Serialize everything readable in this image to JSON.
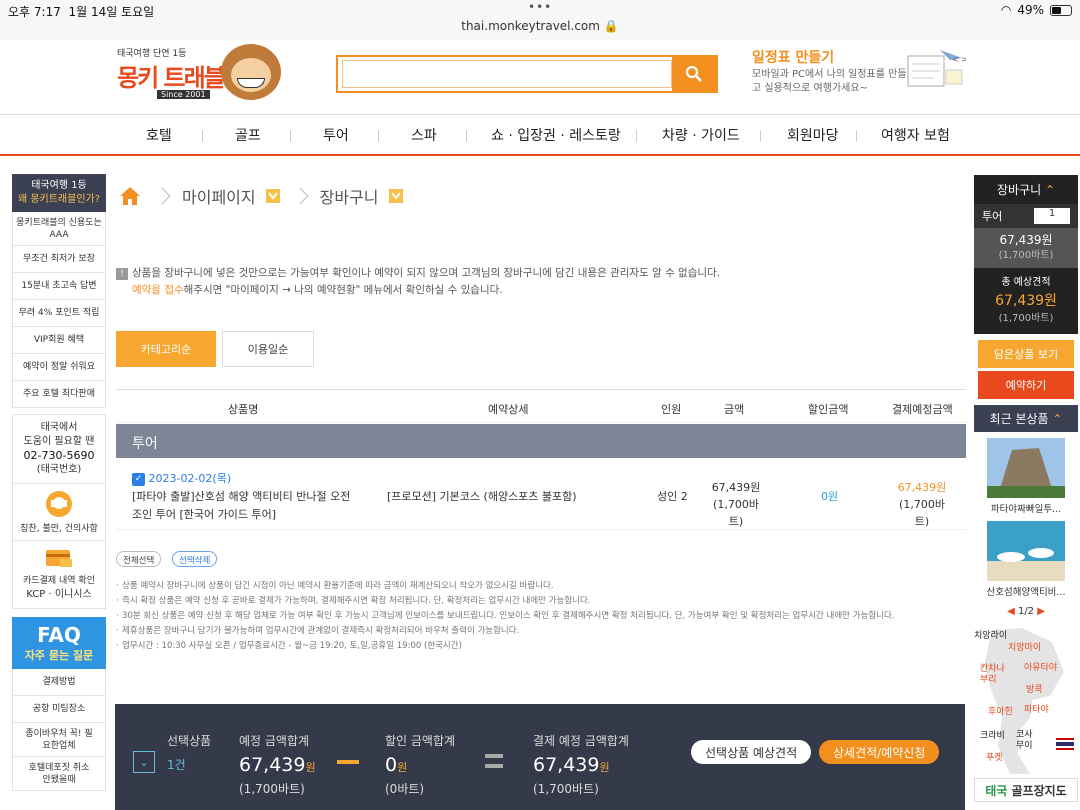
{
  "status": {
    "time": "오후 7:17",
    "date": "1월 14일 토요일",
    "url": "thai.monkeytravel.com",
    "battery": "49%"
  },
  "header": {
    "logo_tag": "태국여행 단연 1등",
    "logo_name": "몽키 트래블",
    "logo_since": "Since 2001",
    "search_placeholder": "",
    "promo_title": "일정표 만들기",
    "promo_desc": "모바일과 PC에서 나의 일정표를 만들고 실용적으로 여행가세요~"
  },
  "nav": [
    "호텔",
    "골프",
    "투어",
    "스파",
    "쇼 · 입장권 · 레스토랑",
    "차량 · 가이드",
    "회원마당",
    "여행자 보험"
  ],
  "left_sidebar": {
    "top_line1": "태국여행 1등",
    "top_line2": "왜 몽키트래블인가?",
    "items": [
      "몽키트래블의 신용도는 AAA",
      "무조건 최저가 보장",
      "15분내 초고속 답변",
      "무려 4% 포인트 적립",
      "VIP회원 혜택",
      "예약이 정말 쉬워요",
      "주요 호텔 최다판매"
    ],
    "contact": [
      "태국에서",
      "도움이 필요할 땐",
      "02-730-5690",
      "(태국번호)"
    ],
    "feedback": "칭찬, 불만, 건의사항",
    "card": "카드결제 내역 확인",
    "card_sub": "KCP · 이니시스",
    "faq_title": "FAQ",
    "faq_sub": "자주 묻는 질문",
    "faq_items": [
      "결제방법",
      "공항 미팅장소",
      "종이바우처 꼭! 필요한업체",
      "호텔데포짓 취소안됐을때"
    ]
  },
  "breadcrumb": {
    "level1": "마이페이지",
    "level2": "장바구니"
  },
  "notice": {
    "line1": "상품을 장바구니에 넣은 것만으로는 가능여부 확인이나 예약이 되지 않으며 고객님의 장바구니에 담긴 내용은 관리자도 알 수 없습니다.",
    "line2_accent": "예약을 접수",
    "line2_rest": "해주시면 \"마이페이지 → 나의 예약현황\" 메뉴에서 확인하실 수 있습니다."
  },
  "sort": {
    "active": "카테고리순",
    "inactive": "이용일순"
  },
  "table": {
    "headers": [
      "상품명",
      "예약상세",
      "인원",
      "금액",
      "할인금액",
      "결제예정금액"
    ],
    "category": "투어",
    "row": {
      "date": "2023-02-02(목)",
      "name_line1": "[파타야 출발]산호섬 해양 액티비티 반나절 오전",
      "name_line2": "조인 투어 [한국어 가이드 투어]",
      "detail": "[프로모션] 기본코스 (해양스포츠 불포함)",
      "people": "성인 2",
      "price": "67,439원",
      "price_baht": "(1,700바트)",
      "discount": "0원",
      "final": "67,439원",
      "final_baht": "(1,700바트)"
    }
  },
  "actions": {
    "select_all": "전체선택",
    "delete_selected": "선택삭제"
  },
  "notes": [
    "상품 예약시 장바구니에 상품이 담긴 시점이 아닌 예약시 환율기준에 따라 금액이 재계산되오니 착오가 없으시길 바랍니다.",
    "즉시 확정 상품은 예약 신청 후 곧바로 결제가 가능하며, 결제해주시면 확정 처리됩니다. 단, 확정처리는 업무시간 내에만 가능합니다.",
    "30분 회신 상품은 예약 신청 후 해당 업체로 가능 여부 확인 후 가능시 고객님께 인보이스를 보내드립니다. 인보이스 확인 후 결제해주시면 확정 처리됩니다. 단, 가능여부 확인 및 확정처리는 업무시간 내에만 가능합니다.",
    "제휴상품은 장바구니 담기가 불가능하며 업무시간에 관계없이 결제즉시 확정처리되어 바우처 출력이 가능합니다.",
    "업무시간 : 10:30 사무실 오픈 / 업무종료시간 - 월~금 19:20, 토,일,공휴일 19:00 (한국시간)"
  ],
  "bottom": {
    "selected_label": "선택상품",
    "selected_count": "1건",
    "total_label": "예정 금액합계",
    "total_value": "67,439",
    "won": "원",
    "total_baht": "(1,700바트)",
    "discount_label": "할인 금액합계",
    "discount_value": "0",
    "discount_baht": "(0바트)",
    "final_label": "결제 예정 금액합계",
    "final_value": "67,439",
    "final_baht": "(1,700바트)",
    "quote_btn": "선택상품 예상견적",
    "reserve_btn": "상세견적/예약신청"
  },
  "cart": {
    "title": "장바구니",
    "row_label": "투어",
    "row_count": "1",
    "price": "67,439원",
    "price_baht": "(1,700바트)",
    "total_label": "총 예상견적",
    "total": "67,439원",
    "total_baht": "(1,700바트)",
    "view_btn": "담은상품 보기",
    "reserve_btn": "예약하기",
    "recent_title": "최근 본상품",
    "recent_items": [
      "파타야짜빠일투...",
      "산호섬해양액티비..."
    ],
    "pager": "1/2",
    "map_labels": [
      "치앙라이",
      "치앙마이",
      "아유타야",
      "칸차나부리",
      "방콕",
      "파타야",
      "후아힌",
      "크라비",
      "코사무이",
      "푸켓"
    ],
    "golf": "태국 골프장지도",
    "golf_accent": "태국"
  },
  "colors": {
    "orange": "#f28f1e",
    "accent_red": "#e8491d",
    "dark": "#343a4a"
  }
}
